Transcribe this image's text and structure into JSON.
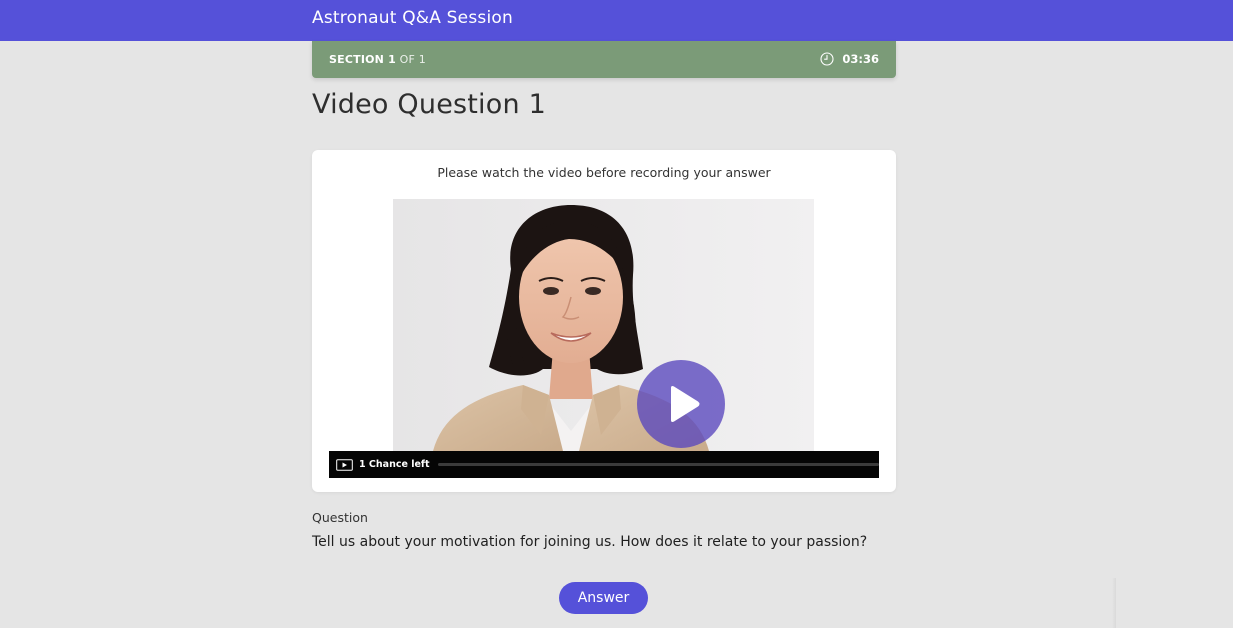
{
  "header": {
    "title": "Astronaut Q&A Session"
  },
  "section": {
    "label_bold": "SECTION 1",
    "label_rest": "OF 1",
    "timer": "03:36",
    "timer_icon": "clock-icon"
  },
  "page": {
    "title": "Video Question 1"
  },
  "video": {
    "instruction": "Please watch the video before recording your answer",
    "chances_left": "1 Chance left",
    "progress": 0,
    "play_icon": "play-icon",
    "controls_icon": "video-icon"
  },
  "question": {
    "label": "Question",
    "text": "Tell us about your motivation for joining us. How does it relate to your passion?"
  },
  "actions": {
    "answer_label": "Answer"
  },
  "colors": {
    "brand": "#5551d9",
    "section_bar": "#7b9b78",
    "background": "#e5e5e5",
    "controls_bar": "#050505"
  }
}
